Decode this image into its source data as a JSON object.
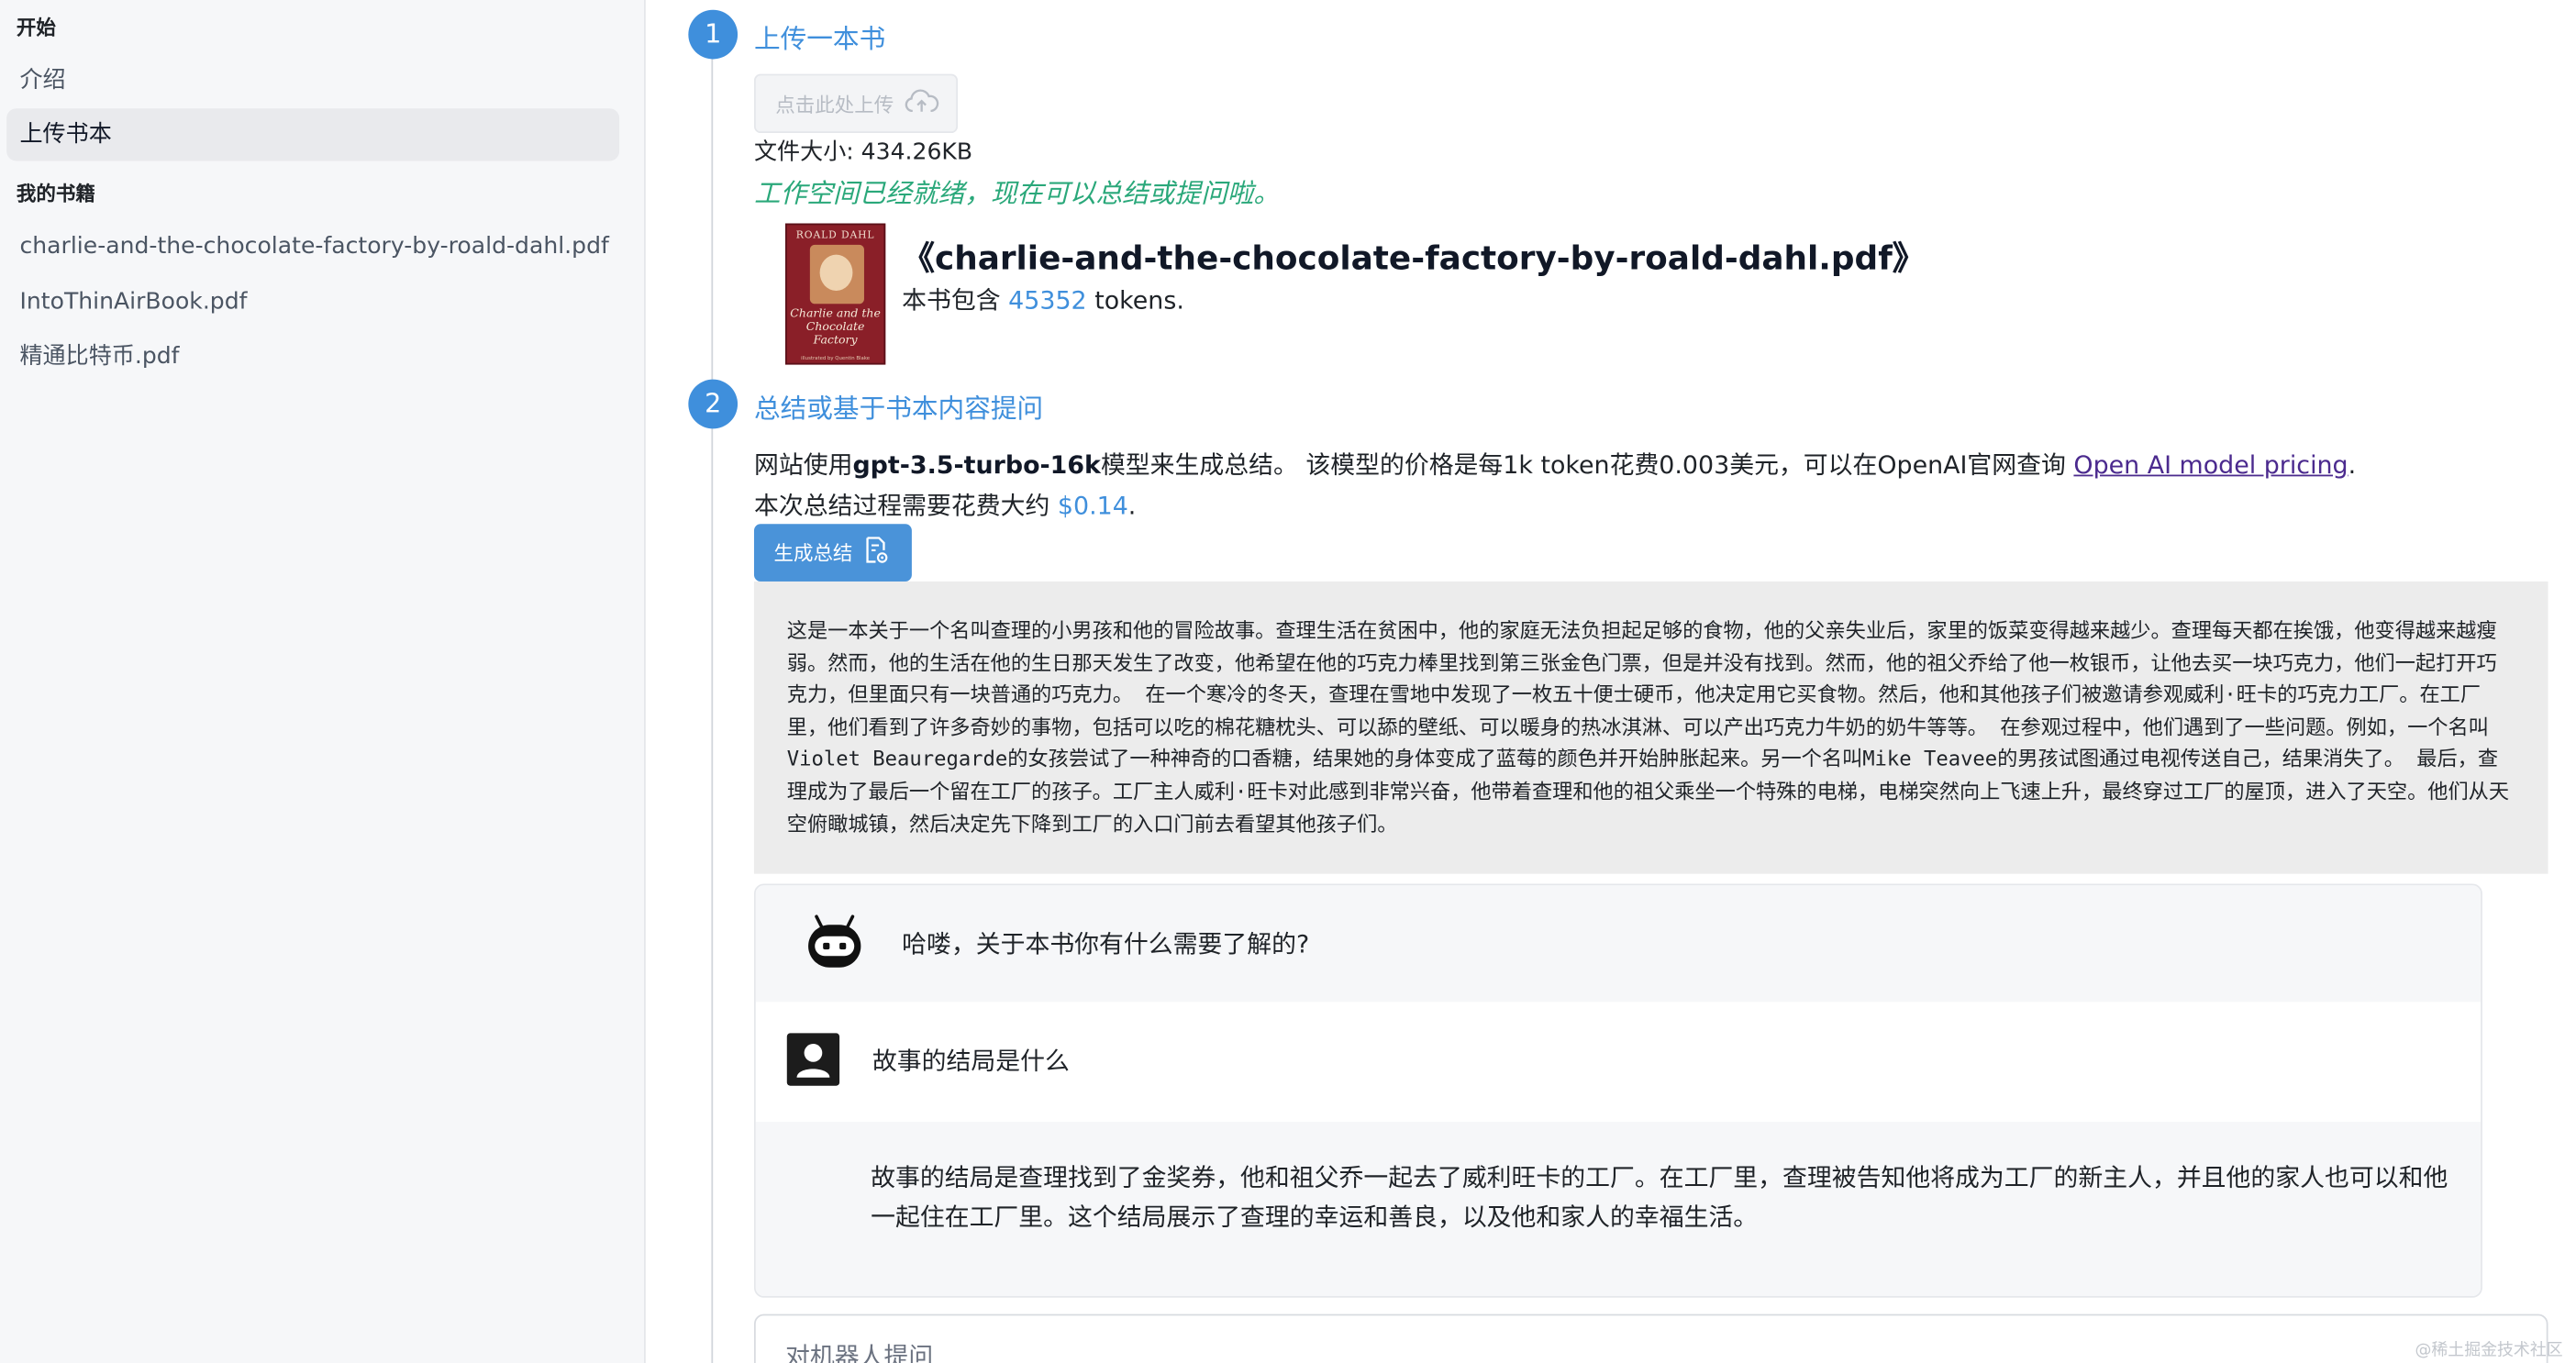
{
  "sidebar": {
    "heading_start": "开始",
    "items_start": [
      {
        "label": "介绍"
      },
      {
        "label": "上传书本"
      }
    ],
    "heading_books": "我的书籍",
    "books": [
      {
        "label": "charlie-and-the-chocolate-factory-by-roald-dahl.pdf"
      },
      {
        "label": "IntoThinAirBook.pdf"
      },
      {
        "label": "精通比特币.pdf"
      }
    ]
  },
  "step1": {
    "number": "1",
    "title": "上传一本书",
    "upload_label": "点击此处上传",
    "upload_icon": "cloud-upload-icon",
    "file_size": "文件大小: 434.26KB",
    "ready_message": "工作空间已经就绪，现在可以总结或提问啦。",
    "book": {
      "cover_author": "ROALD DAHL",
      "cover_title": "Charlie and the Chocolate Factory",
      "cover_small": "illustrated by Quentin Blake",
      "title": "《charlie-and-the-chocolate-factory-by-roald-dahl.pdf》",
      "token_prefix": "本书包含",
      "token_count": "45352",
      "token_suffix": "tokens."
    }
  },
  "step2": {
    "number": "2",
    "title": "总结或基于书本内容提问",
    "model_prefix": "网站使用",
    "model_name": "gpt-3.5-turbo-16k",
    "model_suffix": "模型来生成总结。 该模型的价格是每1k token花费0.003美元，可以在OpenAI官网查询 ",
    "pricing_link": "Open AI model pricing",
    "pricing_end": ".",
    "cost_prefix": "本次总结过程需要花费大约 ",
    "cost_value": "$0.14",
    "cost_end": ".",
    "generate_button": "生成总结",
    "generate_icon": "document-gear-icon",
    "summary": "这是一本关于一个名叫查理的小男孩和他的冒险故事。查理生活在贫困中，他的家庭无法负担起足够的食物，他的父亲失业后，家里的饭菜变得越来越少。查理每天都在挨饿，他变得越来越瘦弱。然而，他的生活在他的生日那天发生了改变，他希望在他的巧克力棒里找到第三张金色门票，但是并没有找到。然而，他的祖父乔给了他一枚银币，让他去买一块巧克力，他们一起打开巧克力，但里面只有一块普通的巧克力。 在一个寒冷的冬天，查理在雪地中发现了一枚五十便士硬币，他决定用它买食物。然后，他和其他孩子们被邀请参观威利·旺卡的巧克力工厂。在工厂里，他们看到了许多奇妙的事物，包括可以吃的棉花糖枕头、可以舔的壁纸、可以暖身的热冰淇淋、可以产出巧克力牛奶的奶牛等等。 在参观过程中，他们遇到了一些问题。例如，一个名叫Violet Beauregarde的女孩尝试了一种神奇的口香糖，结果她的身体变成了蓝莓的颜色并开始肿胀起来。另一个名叫Mike Teavee的男孩试图通过电视传送自己，结果消失了。 最后，查理成为了最后一个留在工厂的孩子。工厂主人威利·旺卡对此感到非常兴奋，他带着查理和他的祖父乘坐一个特殊的电梯，电梯突然向上飞速上升，最终穿过工厂的屋顶，进入了天空。他们从天空俯瞰城镇，然后决定先下降到工厂的入口门前去看望其他孩子们。"
  },
  "chat": {
    "bot_avatar_icon": "robot-icon",
    "user_avatar_icon": "user-icon",
    "greeting": "哈喽，关于本书你有什么需要了解的?",
    "question": "故事的结局是什么",
    "answer": "故事的结局是查理找到了金奖券，他和祖父乔一起去了威利旺卡的工厂。在工厂里，查理被告知他将成为工厂的新主人，并且他的家人也可以和他一起住在工厂里。这个结局展示了查理的幸运和善良，以及他和家人的幸福生活。",
    "input_placeholder": "对机器人提问"
  },
  "watermark": "@稀土掘金技术社区",
  "colors": {
    "accent": "#3f8fdc",
    "ready_green": "#2aa87a",
    "link_purple": "#4b2a8e",
    "sidebar_bg": "#f6f7f9",
    "summary_bg": "#ececec"
  }
}
